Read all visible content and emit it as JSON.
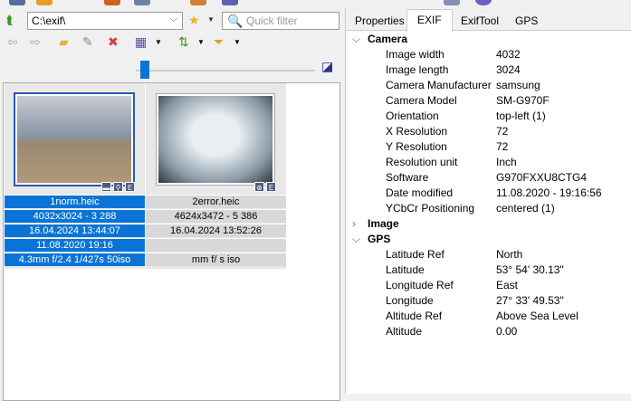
{
  "address": {
    "path": "C:\\exif\\",
    "filter_placeholder": "Quick filter"
  },
  "thumbnails": [
    {
      "name": "1norm.heic",
      "dims": "4032x3024 - 3 288",
      "created": "16.04.2024 13:44:07",
      "taken": "11.08.2020 19:16",
      "exposure": "4.3mm f/2.4 1/427s 50iso",
      "selected": true,
      "badges": [
        "▬",
        "⚲",
        "E"
      ]
    },
    {
      "name": "2error.heic",
      "dims": "4624x3472 - 5 386",
      "created": "16.04.2024 13:52:26",
      "taken": "",
      "exposure": "mm f/ s iso",
      "selected": false,
      "badges": [
        "⊛",
        "E"
      ]
    }
  ],
  "tabs": [
    "Properties",
    "EXIF",
    "ExifTool",
    "GPS"
  ],
  "active_tab": "EXIF",
  "groups": [
    {
      "name": "Camera",
      "expanded": true,
      "rows": [
        [
          "Image width",
          "4032"
        ],
        [
          "Image length",
          "3024"
        ],
        [
          "Camera Manufacturer",
          "samsung"
        ],
        [
          "Camera Model",
          "SM-G970F"
        ],
        [
          "Orientation",
          "top-left (1)"
        ],
        [
          "X Resolution",
          "72"
        ],
        [
          "Y Resolution",
          "72"
        ],
        [
          "Resolution unit",
          "Inch"
        ],
        [
          "Software",
          "G970FXXU8CTG4"
        ],
        [
          "Date modified",
          "11.08.2020 - 19:16:56"
        ],
        [
          "YCbCr Positioning",
          "centered (1)"
        ]
      ]
    },
    {
      "name": "Image",
      "expanded": false,
      "rows": []
    },
    {
      "name": "GPS",
      "expanded": true,
      "rows": [
        [
          "Latitude Ref",
          "North"
        ],
        [
          "Latitude",
          "53° 54' 30.13\""
        ],
        [
          "Longitude Ref",
          "East"
        ],
        [
          "Longitude",
          "27° 33' 49.53\""
        ],
        [
          "Altitude Ref",
          "Above Sea Level"
        ],
        [
          "Altitude",
          "0.00"
        ]
      ]
    }
  ]
}
